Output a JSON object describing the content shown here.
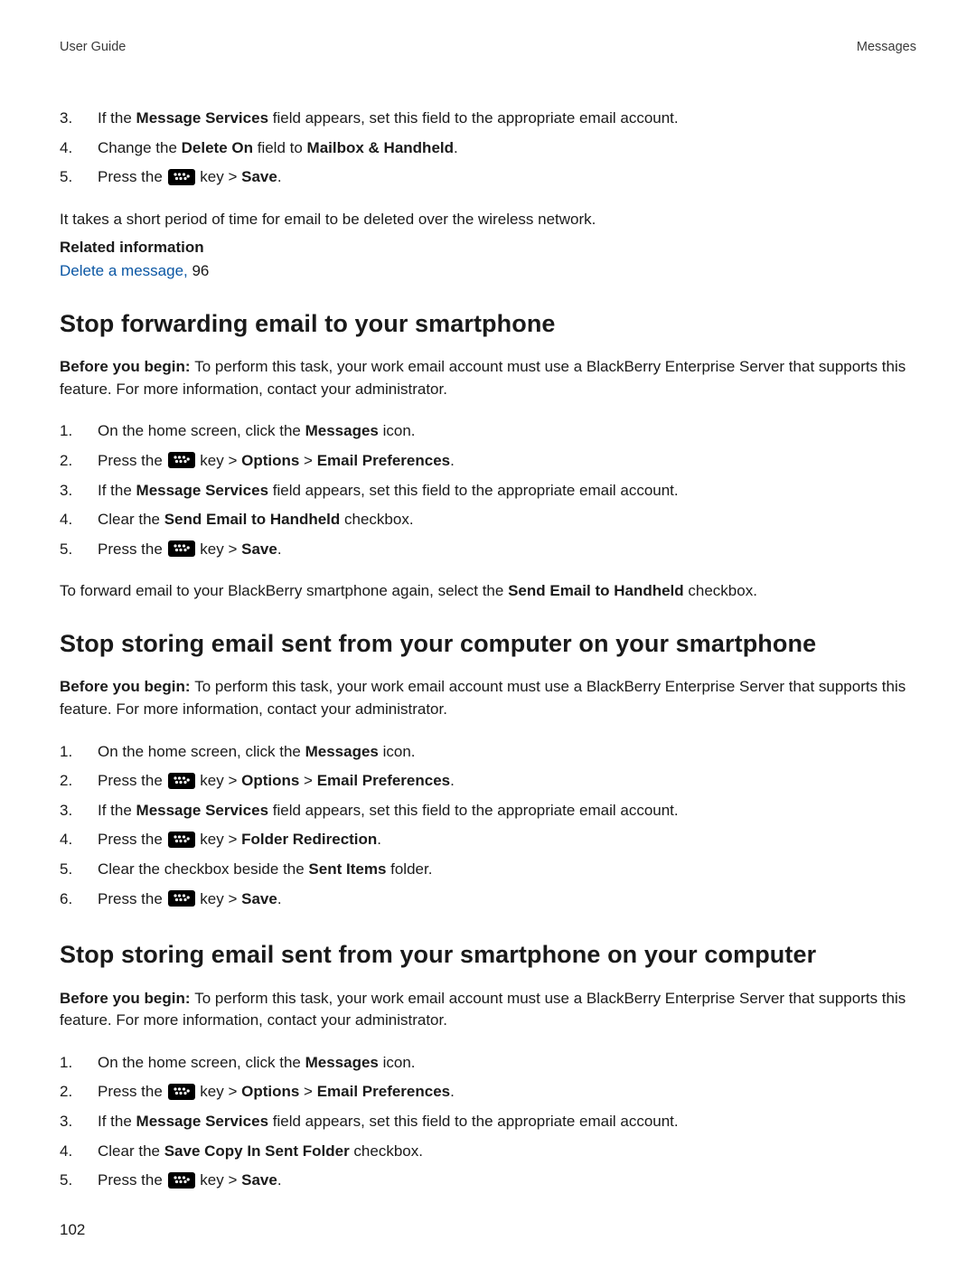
{
  "header": {
    "left": "User Guide",
    "right": "Messages"
  },
  "page_number": "102",
  "section0": {
    "steps": [
      {
        "num": "3.",
        "parts": [
          {
            "t": "If the "
          },
          {
            "t": "Message Services",
            "b": true
          },
          {
            "t": " field appears, set this field to the appropriate email account."
          }
        ]
      },
      {
        "num": "4.",
        "parts": [
          {
            "t": "Change the "
          },
          {
            "t": "Delete On",
            "b": true
          },
          {
            "t": " field to "
          },
          {
            "t": "Mailbox & Handheld",
            "b": true
          },
          {
            "t": "."
          }
        ]
      },
      {
        "num": "5.",
        "parts": [
          {
            "t": "Press the "
          },
          {
            "icon": "bb-key"
          },
          {
            "t": " key > "
          },
          {
            "t": "Save",
            "b": true
          },
          {
            "t": "."
          }
        ]
      }
    ],
    "note": "It takes a short period of time for email to be deleted over the wireless network.",
    "related_heading": "Related information",
    "related_link_text": "Delete a message,",
    "related_link_page": " 96"
  },
  "section1": {
    "title": "Stop forwarding email to your smartphone",
    "before_begin_label": "Before you begin: ",
    "before_begin_text": "To perform this task, your work email account must use a BlackBerry Enterprise Server that supports this feature. For more information, contact your administrator.",
    "steps": [
      {
        "num": "1.",
        "parts": [
          {
            "t": "On the home screen, click the "
          },
          {
            "t": "Messages",
            "b": true
          },
          {
            "t": " icon."
          }
        ]
      },
      {
        "num": "2.",
        "parts": [
          {
            "t": "Press the "
          },
          {
            "icon": "bb-key"
          },
          {
            "t": " key > "
          },
          {
            "t": "Options",
            "b": true
          },
          {
            "t": " > "
          },
          {
            "t": "Email Preferences",
            "b": true
          },
          {
            "t": "."
          }
        ]
      },
      {
        "num": "3.",
        "parts": [
          {
            "t": "If the "
          },
          {
            "t": "Message Services",
            "b": true
          },
          {
            "t": " field appears, set this field to the appropriate email account."
          }
        ]
      },
      {
        "num": "4.",
        "parts": [
          {
            "t": "Clear the "
          },
          {
            "t": "Send Email to Handheld",
            "b": true
          },
          {
            "t": " checkbox."
          }
        ]
      },
      {
        "num": "5.",
        "parts": [
          {
            "t": "Press the "
          },
          {
            "icon": "bb-key"
          },
          {
            "t": " key > "
          },
          {
            "t": "Save",
            "b": true
          },
          {
            "t": "."
          }
        ]
      }
    ],
    "after_note": [
      {
        "t": "To forward email to your BlackBerry smartphone again, select the "
      },
      {
        "t": "Send Email to Handheld",
        "b": true
      },
      {
        "t": " checkbox."
      }
    ]
  },
  "section2": {
    "title": "Stop storing email sent from your computer on your smartphone",
    "before_begin_label": "Before you begin: ",
    "before_begin_text": "To perform this task, your work email account must use a BlackBerry Enterprise Server that supports this feature. For more information, contact your administrator.",
    "steps": [
      {
        "num": "1.",
        "parts": [
          {
            "t": "On the home screen, click the "
          },
          {
            "t": "Messages",
            "b": true
          },
          {
            "t": " icon."
          }
        ]
      },
      {
        "num": "2.",
        "parts": [
          {
            "t": "Press the "
          },
          {
            "icon": "bb-key"
          },
          {
            "t": " key > "
          },
          {
            "t": "Options",
            "b": true
          },
          {
            "t": " > "
          },
          {
            "t": "Email Preferences",
            "b": true
          },
          {
            "t": "."
          }
        ]
      },
      {
        "num": "3.",
        "parts": [
          {
            "t": "If the "
          },
          {
            "t": "Message Services",
            "b": true
          },
          {
            "t": " field appears, set this field to the appropriate email account."
          }
        ]
      },
      {
        "num": "4.",
        "parts": [
          {
            "t": "Press the "
          },
          {
            "icon": "bb-key"
          },
          {
            "t": " key > "
          },
          {
            "t": "Folder Redirection",
            "b": true
          },
          {
            "t": "."
          }
        ]
      },
      {
        "num": "5.",
        "parts": [
          {
            "t": "Clear the checkbox beside the "
          },
          {
            "t": "Sent Items",
            "b": true
          },
          {
            "t": " folder."
          }
        ]
      },
      {
        "num": "6.",
        "parts": [
          {
            "t": "Press the "
          },
          {
            "icon": "bb-key"
          },
          {
            "t": " key > "
          },
          {
            "t": "Save",
            "b": true
          },
          {
            "t": "."
          }
        ]
      }
    ]
  },
  "section3": {
    "title": "Stop storing email sent from your smartphone on your computer",
    "before_begin_label": "Before you begin: ",
    "before_begin_text": "To perform this task, your work email account must use a BlackBerry Enterprise Server that supports this feature. For more information, contact your administrator.",
    "steps": [
      {
        "num": "1.",
        "parts": [
          {
            "t": "On the home screen, click the "
          },
          {
            "t": "Messages",
            "b": true
          },
          {
            "t": " icon."
          }
        ]
      },
      {
        "num": "2.",
        "parts": [
          {
            "t": "Press the "
          },
          {
            "icon": "bb-key"
          },
          {
            "t": " key > "
          },
          {
            "t": "Options",
            "b": true
          },
          {
            "t": " > "
          },
          {
            "t": "Email Preferences",
            "b": true
          },
          {
            "t": "."
          }
        ]
      },
      {
        "num": "3.",
        "parts": [
          {
            "t": "If the "
          },
          {
            "t": "Message Services",
            "b": true
          },
          {
            "t": " field appears, set this field to the appropriate email account."
          }
        ]
      },
      {
        "num": "4.",
        "parts": [
          {
            "t": "Clear the "
          },
          {
            "t": "Save Copy In Sent Folder",
            "b": true
          },
          {
            "t": " checkbox."
          }
        ]
      },
      {
        "num": "5.",
        "parts": [
          {
            "t": "Press the "
          },
          {
            "icon": "bb-key"
          },
          {
            "t": " key > "
          },
          {
            "t": "Save",
            "b": true
          },
          {
            "t": "."
          }
        ]
      }
    ]
  }
}
